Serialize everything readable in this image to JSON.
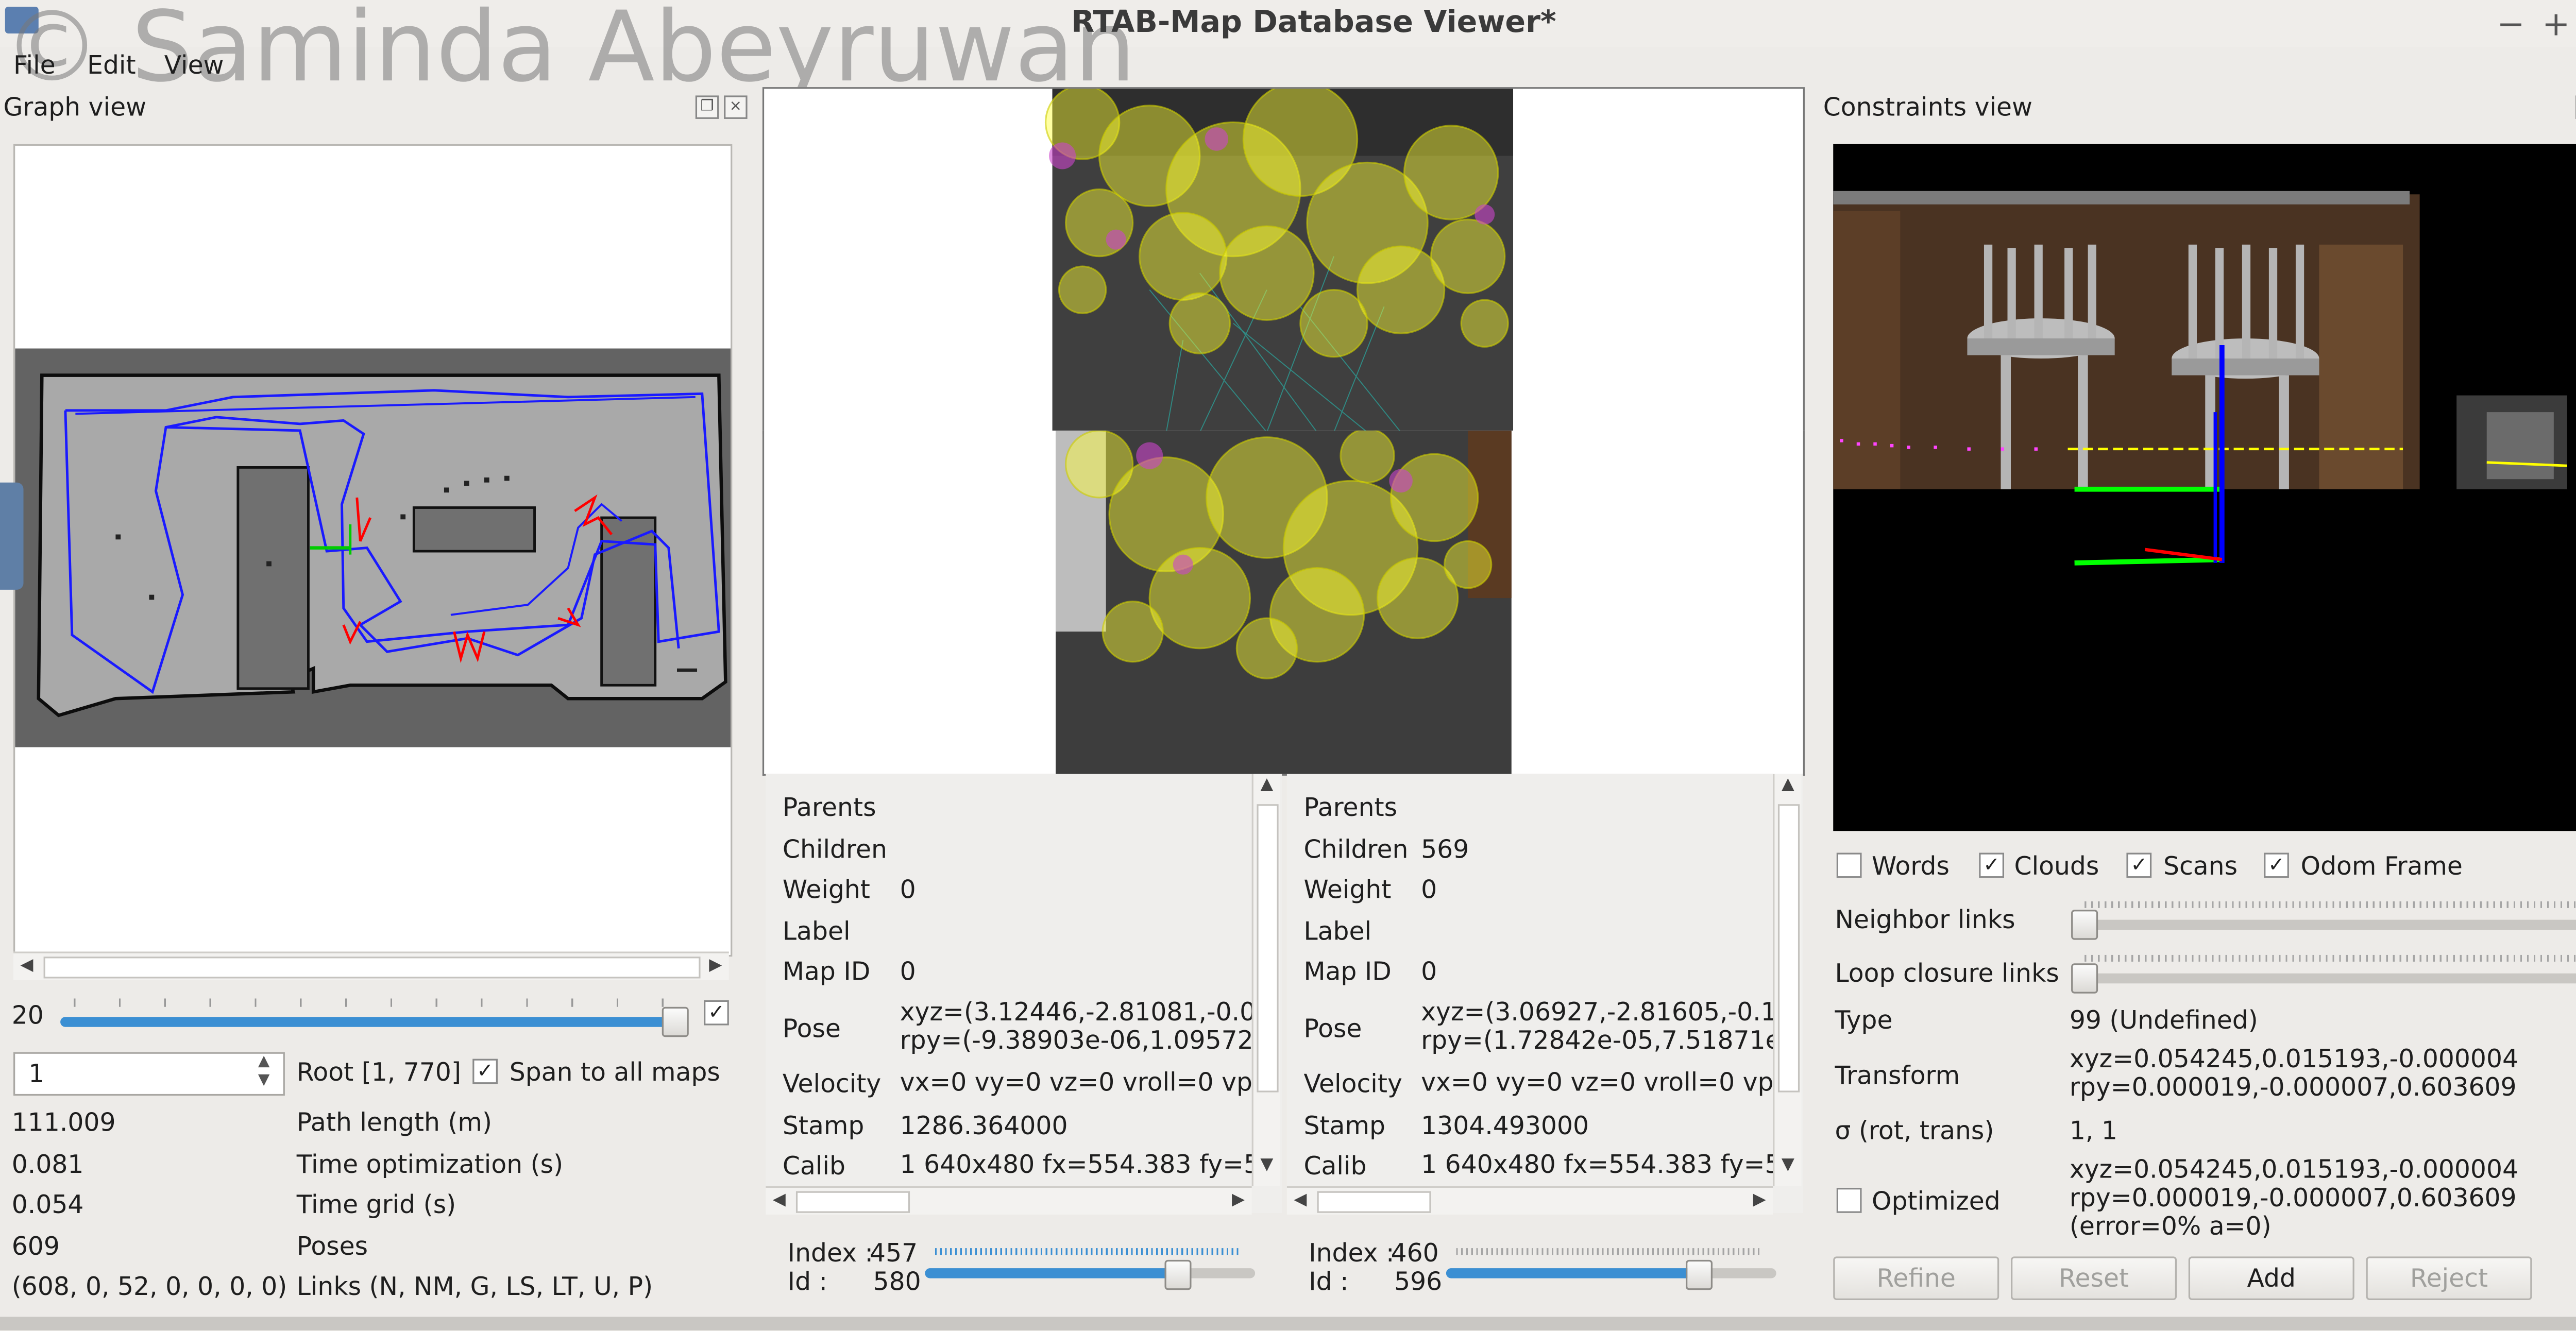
{
  "window": {
    "title": "RTAB-Map Database Viewer*",
    "watermark": "© Saminda Abeyruwan",
    "controls": [
      "−",
      "+",
      "×"
    ]
  },
  "menu": {
    "items": [
      "File",
      "Edit",
      "View"
    ]
  },
  "graph_view": {
    "title": "Graph view",
    "slider_value": "20",
    "spin_value": "1",
    "root_label": "Root [1, 770]",
    "span_label": "Span to all maps",
    "stats": [
      {
        "value": "111.009",
        "label": "Path length (m)"
      },
      {
        "value": "0.081",
        "label": "Time optimization (s)"
      },
      {
        "value": "0.054",
        "label": "Time grid (s)"
      },
      {
        "value": "609",
        "label": "Poses"
      },
      {
        "value": "(608, 0, 52, 0, 0, 0, 0)",
        "label": "Links (N, NM, G, LS, LT, U, P)"
      }
    ]
  },
  "left_info": {
    "rows": [
      {
        "label": "Parents",
        "value": ""
      },
      {
        "label": "Children",
        "value": ""
      },
      {
        "label": "Weight",
        "value": "0"
      },
      {
        "label": "Label",
        "value": ""
      },
      {
        "label": "Map ID",
        "value": "0"
      },
      {
        "label": "Pose",
        "value": "xyz=(3.12446,-2.81081,-0.0",
        "value2": "rpy=(-9.38903e-06,1.09572e"
      },
      {
        "label": "Velocity",
        "value": "vx=0 vy=0 vz=0 vroll=0 vpi"
      },
      {
        "label": "Stamp",
        "value": "1286.364000"
      },
      {
        "label": "Calib",
        "value": "1 640x480 fx=554.383 fy=5"
      }
    ],
    "index_label": "Index :",
    "index_value": "457",
    "id_label": "Id :",
    "id_value": "580",
    "slider_fraction": 0.76
  },
  "right_info": {
    "rows": [
      {
        "label": "Parents",
        "value": ""
      },
      {
        "label": "Children",
        "value": "569"
      },
      {
        "label": "Weight",
        "value": "0"
      },
      {
        "label": "Label",
        "value": ""
      },
      {
        "label": "Map ID",
        "value": "0"
      },
      {
        "label": "Pose",
        "value": "xyz=(3.06927,-2.81605,-0.1",
        "value2": "rpy=(1.72842e-05,7.51871e"
      },
      {
        "label": "Velocity",
        "value": "vx=0 vy=0 vz=0 vroll=0 vpi"
      },
      {
        "label": "Stamp",
        "value": "1304.493000"
      },
      {
        "label": "Calib",
        "value": "1 640x480 fx=554.383 fy=5"
      }
    ],
    "index_label": "Index :",
    "index_value": "460",
    "id_label": "Id :",
    "id_value": "596",
    "slider_fraction": 0.76
  },
  "constraints_view": {
    "title": "Constraints view",
    "checkboxes": [
      {
        "label": "Words",
        "checked": false
      },
      {
        "label": "Clouds",
        "checked": true
      },
      {
        "label": "Scans",
        "checked": true
      },
      {
        "label": "Odom Frame",
        "checked": true
      }
    ],
    "neighbor_label": "Neighbor links",
    "loop_label": "Loop closure links",
    "type_label": "Type",
    "type_value": "99 (Undefined)",
    "transform_label": "Transform",
    "transform_line1": "xyz=0.054245,0.015193,-0.000004",
    "transform_line2": "rpy=0.000019,-0.000007,0.603609",
    "sigma_label": "σ (rot, trans)",
    "sigma_value": "1, 1",
    "optimized_label": "Optimized",
    "optimized_line1": "xyz=0.054245,0.015193,-0.000004",
    "optimized_line2": "rpy=0.000019,-0.000007,0.603609",
    "optimized_line3": "(error=0% a=0)",
    "buttons": {
      "refine": "Refine",
      "reset": "Reset",
      "add": "Add",
      "reject": "Reject"
    }
  },
  "colors": {
    "accent": "#3b8fd3",
    "graph_path": "#1a1aff",
    "loop_links": "#ff0000",
    "feature": "#ffff00"
  }
}
